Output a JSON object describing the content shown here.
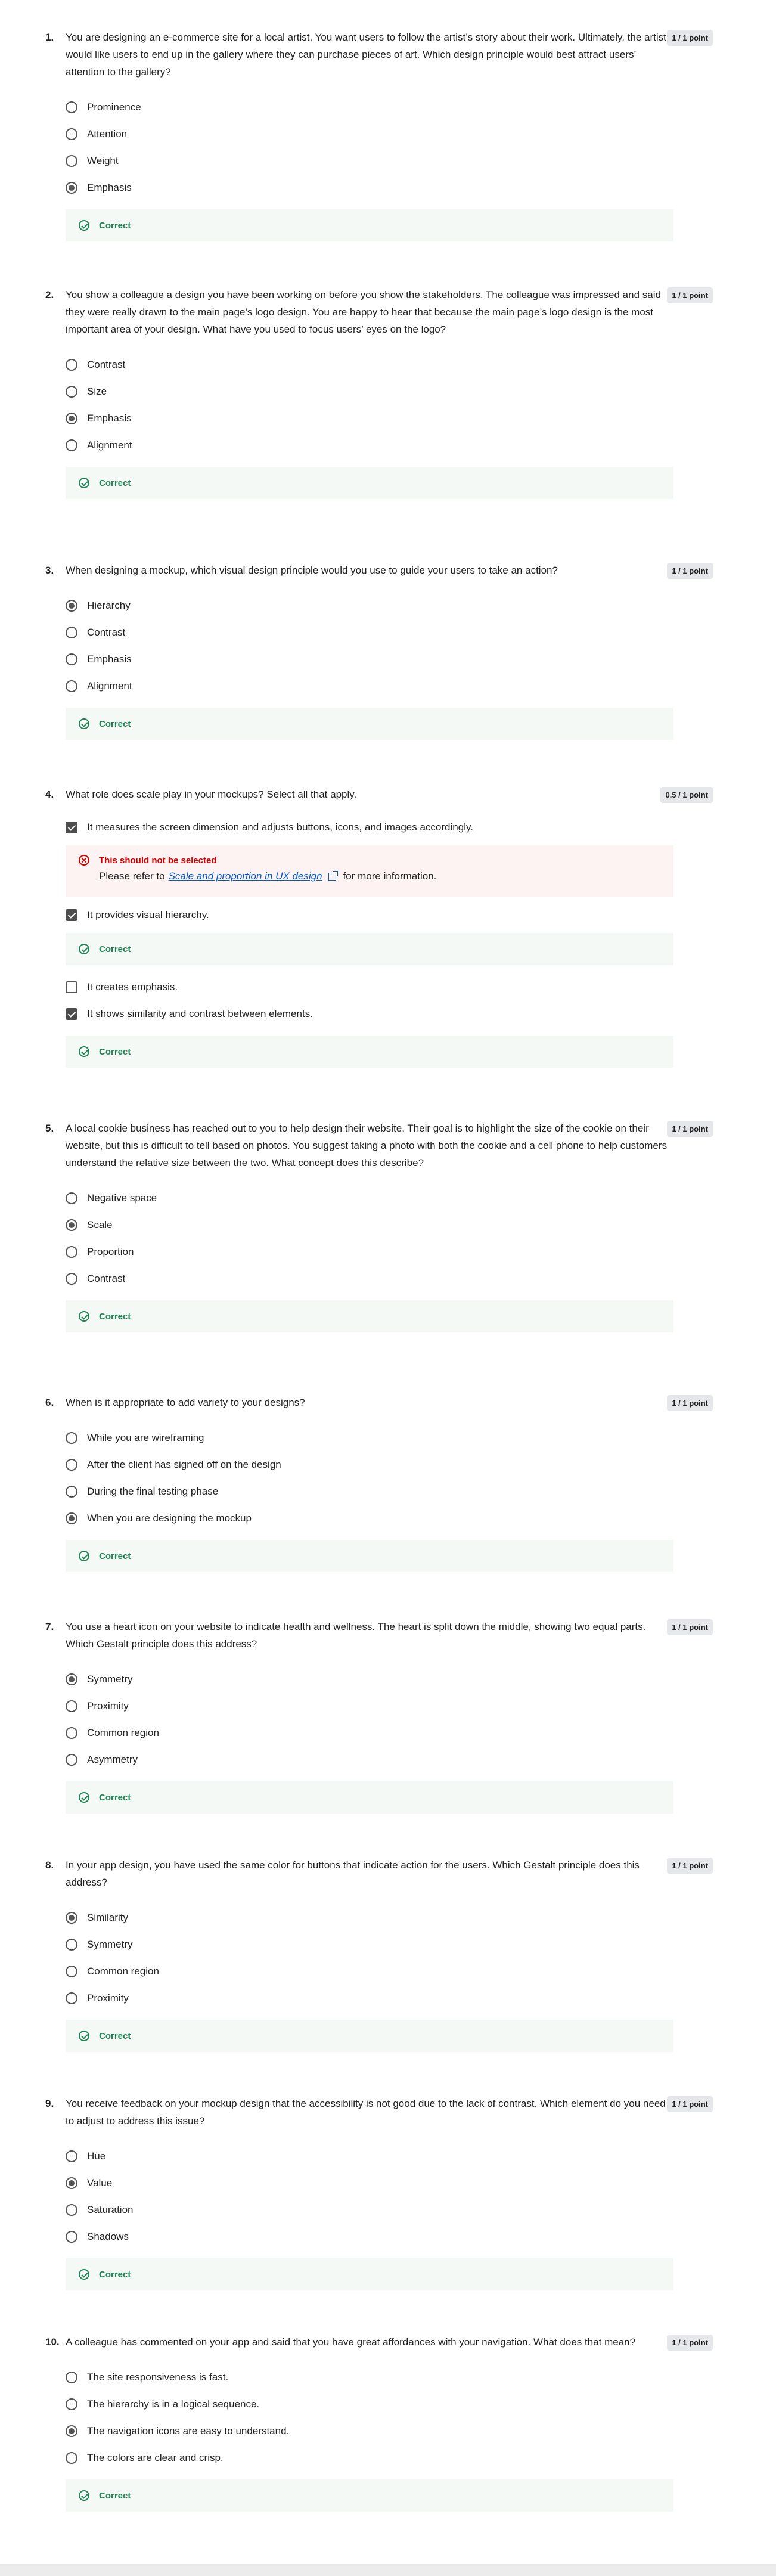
{
  "questions": [
    {
      "number": "1.",
      "points": "1 / 1 point",
      "text": "You are designing an e-commerce site for a local artist. You want users to follow the artist’s story about their work. Ultimately, the artist would like users to end up in the gallery where they can purchase pieces of art. Which design principle would best attract users’ attention to the gallery?",
      "options": [
        {
          "label": "Prominence",
          "selected": false
        },
        {
          "label": "Attention",
          "selected": false
        },
        {
          "label": "Weight",
          "selected": false
        },
        {
          "label": "Emphasis",
          "selected": true
        }
      ],
      "feedback": "Correct"
    },
    {
      "number": "2.",
      "points": "1 / 1 point",
      "text": "You show a colleague a design you have been working on before you show the stakeholders. The colleague was impressed and said they were really drawn to the main page’s logo design. You are happy to hear that because the main page’s logo design is the most important area of your design. What have you used to focus users’ eyes on the logo?",
      "options": [
        {
          "label": "Contrast",
          "selected": false
        },
        {
          "label": "Size",
          "selected": false
        },
        {
          "label": "Emphasis",
          "selected": true
        },
        {
          "label": "Alignment",
          "selected": false
        }
      ],
      "feedback": "Correct"
    },
    {
      "number": "3.",
      "points": "1 / 1 point",
      "text": "When designing a mockup, which visual design principle would you use to guide your users to take an action?",
      "options": [
        {
          "label": "Hierarchy",
          "selected": true
        },
        {
          "label": "Contrast",
          "selected": false
        },
        {
          "label": "Emphasis",
          "selected": false
        },
        {
          "label": "Alignment",
          "selected": false
        }
      ],
      "feedback": "Correct"
    },
    {
      "number": "4.",
      "points": "0.5 / 1 point",
      "text": "What role does scale play in your mockups? Select all that apply.",
      "options": [
        {
          "label": "It measures the screen dimension and adjusts buttons, icons, and images accordingly.",
          "selected": true
        },
        {
          "label": "It provides visual hierarchy.",
          "selected": true
        },
        {
          "label": "It creates emphasis.",
          "selected": false
        },
        {
          "label": "It shows similarity and contrast between elements.",
          "selected": true
        }
      ],
      "wrong_feedback": {
        "title": "This should not be selected",
        "prefix": "Please refer to",
        "link": "Scale and proportion in UX design",
        "suffix": "for more information."
      },
      "feedback": "Correct"
    },
    {
      "number": "5.",
      "points": "1 / 1 point",
      "text": "A local cookie business has reached out to you to help design their website. Their goal is to highlight the size of the cookie on their website, but this is difficult to tell based on photos. You suggest taking a photo with both the cookie and a cell phone to help customers understand the relative size between the two. What concept does this describe?",
      "options": [
        {
          "label": "Negative space",
          "selected": false
        },
        {
          "label": "Scale",
          "selected": true
        },
        {
          "label": "Proportion",
          "selected": false
        },
        {
          "label": "Contrast",
          "selected": false
        }
      ],
      "feedback": "Correct"
    },
    {
      "number": "6.",
      "points": "1 / 1 point",
      "text": "When is it appropriate to add variety to your designs?",
      "options": [
        {
          "label": "While you are wireframing",
          "selected": false
        },
        {
          "label": "After the client has signed off on the design",
          "selected": false
        },
        {
          "label": "During the final testing phase",
          "selected": false
        },
        {
          "label": "When you are designing the mockup",
          "selected": true
        }
      ],
      "feedback": "Correct"
    },
    {
      "number": "7.",
      "points": "1 / 1 point",
      "text": "You use a heart icon on your website to indicate health and wellness. The heart is split down the middle, showing two equal parts. Which Gestalt principle does this address?",
      "options": [
        {
          "label": "Symmetry",
          "selected": true
        },
        {
          "label": "Proximity",
          "selected": false
        },
        {
          "label": "Common region",
          "selected": false
        },
        {
          "label": "Asymmetry",
          "selected": false
        }
      ],
      "feedback": "Correct"
    },
    {
      "number": "8.",
      "points": "1 / 1 point",
      "text": "In your app design, you have used the same color for buttons that indicate action for the users. Which Gestalt principle does this address?",
      "options": [
        {
          "label": "Similarity",
          "selected": true
        },
        {
          "label": "Symmetry",
          "selected": false
        },
        {
          "label": "Common region",
          "selected": false
        },
        {
          "label": "Proximity",
          "selected": false
        }
      ],
      "feedback": "Correct"
    },
    {
      "number": "9.",
      "points": "1 / 1 point",
      "text": "You receive feedback on your mockup design that the accessibility is not good due to the lack of contrast. Which element do you need to adjust to address this issue?",
      "options": [
        {
          "label": "Hue",
          "selected": false
        },
        {
          "label": "Value",
          "selected": true
        },
        {
          "label": "Saturation",
          "selected": false
        },
        {
          "label": "Shadows",
          "selected": false
        }
      ],
      "feedback": "Correct"
    },
    {
      "number": "10.",
      "points": "1 / 1 point",
      "text": "A colleague has commented on your app and said that you have great affordances with your navigation. What does that mean?",
      "options": [
        {
          "label": "The site responsiveness is fast.",
          "selected": false
        },
        {
          "label": "The hierarchy is in a logical sequence.",
          "selected": false
        },
        {
          "label": "The navigation icons are easy to understand.",
          "selected": true
        },
        {
          "label": "The colors are clear and crisp.",
          "selected": false
        }
      ],
      "feedback": "Correct"
    }
  ],
  "colors": {
    "correct": "#1f8354",
    "incorrect": "#d30001",
    "link": "#0056d2",
    "badge_bg": "#e5e7ea"
  }
}
